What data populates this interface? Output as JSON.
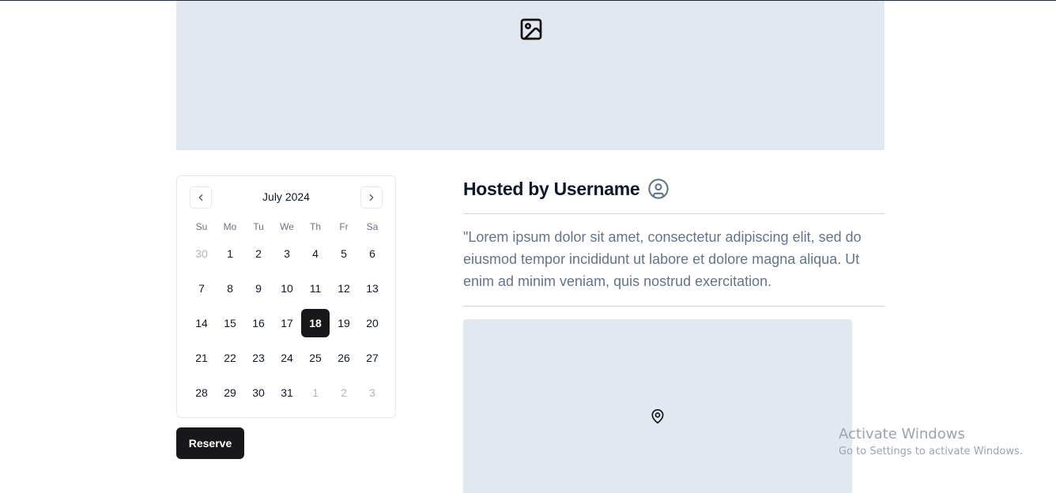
{
  "hero": {
    "icon": "image-icon"
  },
  "calendar": {
    "month_label": "July 2024",
    "prev_icon": "chevron-left-icon",
    "next_icon": "chevron-right-icon",
    "weekdays": [
      "Su",
      "Mo",
      "Tu",
      "We",
      "Th",
      "Fr",
      "Sa"
    ],
    "weeks": [
      [
        "30",
        "1",
        "2",
        "3",
        "4",
        "5",
        "6"
      ],
      [
        "7",
        "8",
        "9",
        "10",
        "11",
        "12",
        "13"
      ],
      [
        "14",
        "15",
        "16",
        "17",
        "18",
        "19",
        "20"
      ],
      [
        "21",
        "22",
        "23",
        "24",
        "25",
        "26",
        "27"
      ],
      [
        "28",
        "29",
        "30",
        "31",
        "1",
        "2",
        "3"
      ]
    ],
    "selected_day": "18"
  },
  "reserve_label": "Reserve",
  "host": {
    "title": "Hosted by Username",
    "icon": "user-circle-icon"
  },
  "description": "\"Lorem ipsum dolor sit amet, consectetur adipiscing elit, sed do eiusmod tempor incididunt ut labore et dolore magna aliqua. Ut enim ad minim veniam, quis nostrud exercitation.",
  "map": {
    "icon": "map-pin-icon"
  },
  "watermark": {
    "title": "Activate Windows",
    "subtitle": "Go to Settings to activate Windows."
  }
}
